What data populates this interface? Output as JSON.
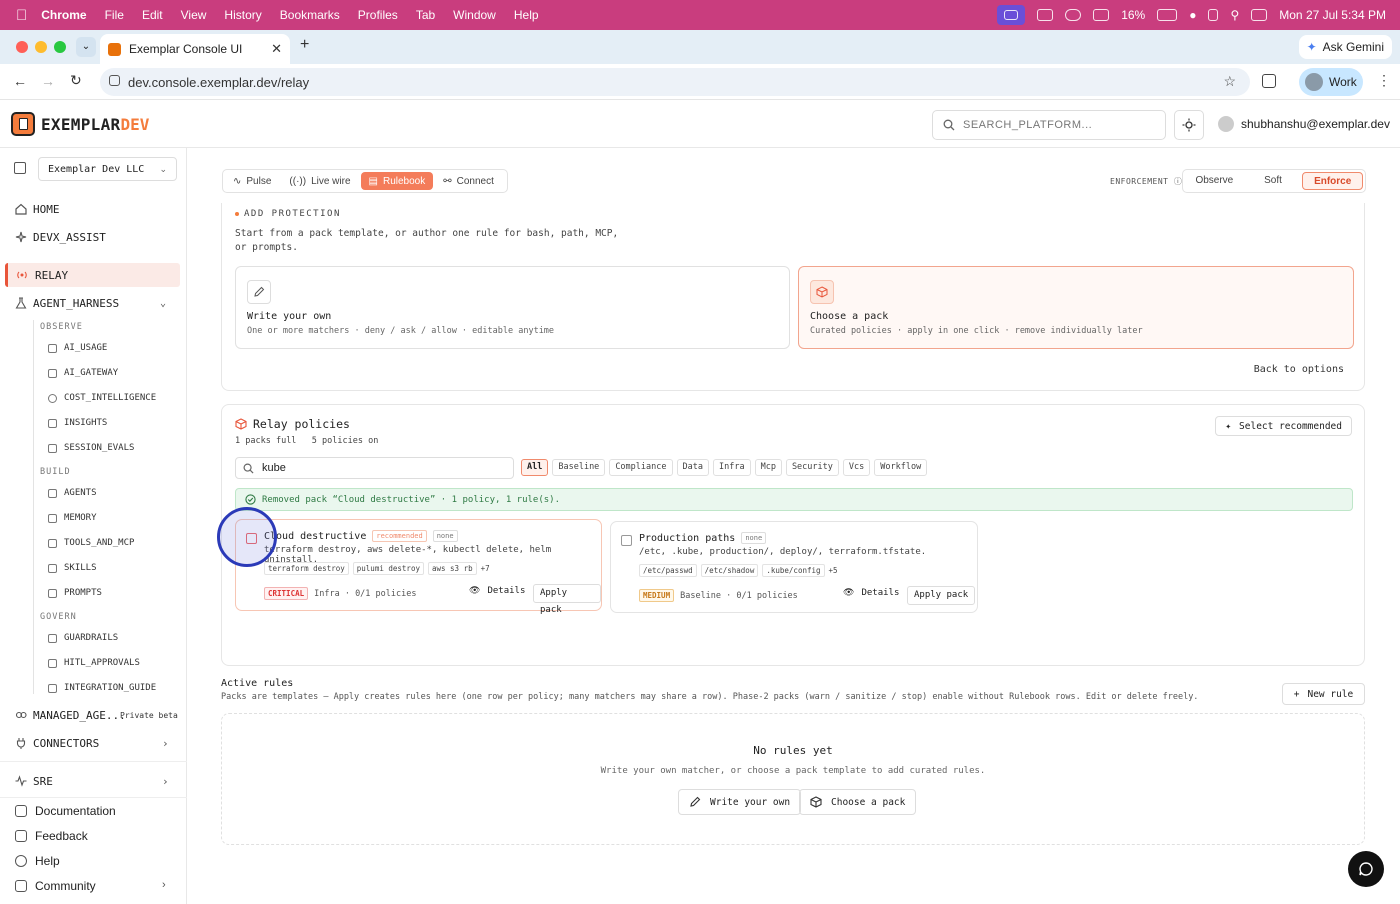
{
  "menubar": {
    "app": "Chrome",
    "items": [
      "File",
      "Edit",
      "View",
      "History",
      "Bookmarks",
      "Profiles",
      "Tab",
      "Window",
      "Help"
    ],
    "battery": "16%",
    "datetime": "Mon 27 Jul  5:34 PM"
  },
  "browser": {
    "tab_title": "Exemplar Console UI",
    "ask_gemini": "Ask Gemini",
    "url": "dev.console.exemplar.dev/relay",
    "profile": "Work"
  },
  "header": {
    "logo_main": "EXEMPLAR",
    "logo_accent": "DEV",
    "search_placeholder": "SEARCH_PLATFORM...",
    "user_email": "shubhanshu@exemplar.dev"
  },
  "sidebar": {
    "org": "Exemplar Dev LLC",
    "home": "HOME",
    "devx": "DEVX_ASSIST",
    "relay": "RELAY",
    "agent_harness": "AGENT_HARNESS",
    "observe": "OBSERVE",
    "observe_items": [
      "AI_USAGE",
      "AI_GATEWAY",
      "COST_INTELLIGENCE",
      "INSIGHTS",
      "SESSION_EVALS"
    ],
    "build": "BUILD",
    "build_items": [
      "AGENTS",
      "MEMORY",
      "TOOLS_AND_MCP",
      "SKILLS",
      "PROMPTS"
    ],
    "govern": "GOVERN",
    "govern_items": [
      "GUARDRAILS",
      "HITL_APPROVALS",
      "INTEGRATION_GUIDE"
    ],
    "managed": "MANAGED_AGE...",
    "managed_badge": "Private beta",
    "connectors": "CONNECTORS",
    "sre": "SRE",
    "documentation": "Documentation",
    "feedback": "Feedback",
    "help": "Help",
    "community": "Community"
  },
  "tabs": [
    "Pulse",
    "Live wire",
    "Rulebook",
    "Connect"
  ],
  "enforcement": {
    "label": "ENFORCEMENT",
    "options": [
      "Observe",
      "Soft",
      "Enforce"
    ],
    "selected": "Enforce"
  },
  "add_protection": {
    "title": "ADD PROTECTION",
    "desc": "Start from a pack template, or author one rule for bash, path, MCP, or prompts.",
    "write_title": "Write your own",
    "write_sub": "One or more matchers · deny / ask / allow · editable anytime",
    "pack_title": "Choose a pack",
    "pack_sub": "Curated policies · apply in one click · remove individually later",
    "back": "Back to options"
  },
  "policies": {
    "title": "Relay policies",
    "packs_count": "1",
    "packs_label": "packs full",
    "policies_count": "5",
    "policies_label": "policies on",
    "select_recommended": "Select recommended",
    "search_value": "kube",
    "filters": [
      "All",
      "Baseline",
      "Compliance",
      "Data",
      "Infra",
      "Mcp",
      "Security",
      "Vcs",
      "Workflow"
    ],
    "toast": "Removed pack “Cloud destructive” · 1 policy, 1 rule(s).",
    "cards": [
      {
        "name": "Cloud destructive",
        "tag_rec": "recommended",
        "tag_none": "none",
        "cmd": "terraform destroy, aws delete-*, kubectl delete, helm uninstall.",
        "matchers": [
          "terraform destroy",
          "pulumi destroy",
          "aws s3 rb"
        ],
        "more": "+7",
        "severity": "CRITICAL",
        "meta": "Infra · 0/1 policies",
        "details": "Details",
        "apply": "Apply pack"
      },
      {
        "name": "Production paths",
        "tag_none": "none",
        "cmd": "/etc, .kube, production/, deploy/, terraform.tfstate.",
        "matchers": [
          "/etc/passwd",
          "/etc/shadow",
          ".kube/config"
        ],
        "more": "+5",
        "severity": "MEDIUM",
        "meta": "Baseline · 0/1 policies",
        "details": "Details",
        "apply": "Apply pack"
      }
    ]
  },
  "active_rules": {
    "title": "Active rules",
    "desc": "Packs are templates — Apply creates rules here (one row per policy; many matchers may share a row). Phase-2 packs (warn / sanitize / stop) enable without Rulebook rows. Edit or delete freely.",
    "new_rule": "New rule",
    "empty_title": "No rules yet",
    "empty_desc": "Write your own matcher, or choose a pack template to add curated rules.",
    "write_btn": "Write your own",
    "pack_btn": "Choose a pack"
  },
  "colors": {
    "accent": "#f47c3c",
    "menubar": "#c93d7e",
    "active_bg": "#fbeae6",
    "toast_bg": "#eaf7ee"
  }
}
